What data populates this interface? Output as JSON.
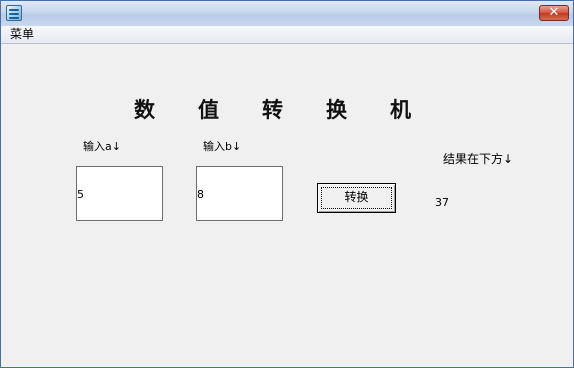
{
  "window": {
    "title": ""
  },
  "menu": {
    "items": [
      "菜单"
    ]
  },
  "heading": {
    "chars": [
      "数",
      "值",
      "转",
      "换",
      "机"
    ]
  },
  "inputs": {
    "a": {
      "label": "输入a↓",
      "value": "5"
    },
    "b": {
      "label": "输入b↓",
      "value": "8"
    }
  },
  "convert_button": {
    "label": "转换"
  },
  "result": {
    "label": "结果在下方↓",
    "value": "37"
  },
  "icons": {
    "app": "app-icon",
    "close": "close-icon"
  }
}
